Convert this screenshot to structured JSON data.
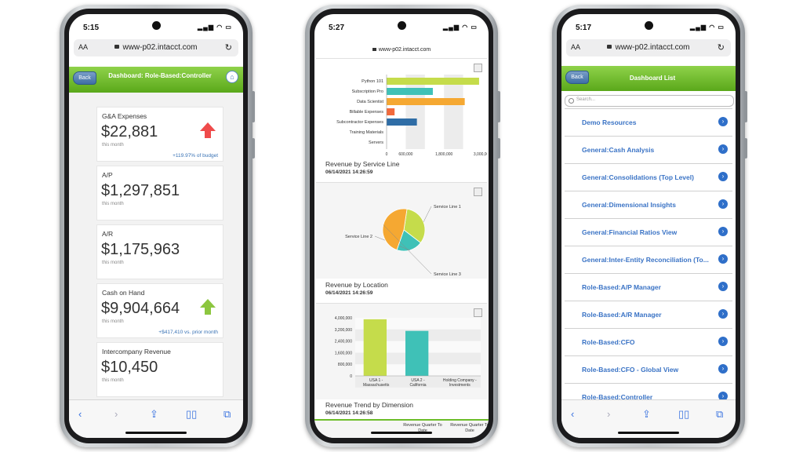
{
  "phone1": {
    "time": "5:15",
    "url": "www-p02.intacct.com",
    "aa": "AA",
    "back": "Back",
    "title": "Dashboard: Role-Based:Controller",
    "kpis": [
      {
        "label": "G&A Expenses",
        "value": "$22,881",
        "sub": "this month",
        "note": "+119.97% of budget",
        "trend": "up-red"
      },
      {
        "label": "A/P",
        "value": "$1,297,851",
        "sub": "this month",
        "note": "",
        "trend": ""
      },
      {
        "label": "A/R",
        "value": "$1,175,963",
        "sub": "this month",
        "note": "",
        "trend": ""
      },
      {
        "label": "Cash on Hand",
        "value": "$9,904,664",
        "sub": "this month",
        "note": "+$417,410 vs. prior month",
        "trend": "up-green"
      },
      {
        "label": "Intercompany Revenue",
        "value": "$10,450",
        "sub": "this month",
        "note": "",
        "trend": ""
      }
    ]
  },
  "phone2": {
    "time": "5:27",
    "url": "www-p02.intacct.com",
    "hbar": {
      "categories": [
        "Python 101",
        "Subscription Pro",
        "Data Scientist",
        "Billable Expenses",
        "Subcontractor Expenses",
        "Training Materials",
        "Servers"
      ],
      "values": [
        2900000,
        1450000,
        2450000,
        250000,
        950000,
        0,
        0
      ],
      "colors": [
        "#c5dc4b",
        "#3fc1b7",
        "#f5a832",
        "#f26a3b",
        "#2f6da6",
        "#888888",
        "#888888"
      ],
      "ticks": [
        "0",
        "600,000",
        "1,800,000",
        "3,000,000"
      ],
      "title": "Revenue by Service Line",
      "date": "06/14/2021 14:26:59"
    },
    "pie": {
      "labels": [
        "Service Line 1",
        "Service Line 2",
        "Service Line 3"
      ],
      "values": [
        33,
        20,
        47
      ],
      "colors": [
        "#c5dc4b",
        "#3fc1b7",
        "#f5a832"
      ],
      "title": "Revenue by Location",
      "date": "06/14/2021 14:26:59"
    },
    "vbar": {
      "categories": [
        "USA 1 - Massachusetts",
        "USA 2 - California",
        "Holding Company - Investments"
      ],
      "values": [
        3900000,
        3100000,
        0
      ],
      "colors": [
        "#c5dc4b",
        "#3fc1b7",
        "#888888"
      ],
      "yticks": [
        "4,000,000",
        "3,200,000",
        "2,400,000",
        "1,600,000",
        "800,000",
        "0"
      ],
      "title": "Revenue Trend by Dimension",
      "date": "06/14/2021 14:26:58"
    },
    "table_headers": [
      "Revenue Quarter To Date",
      "Revenue Quarter To Date"
    ]
  },
  "phone3": {
    "time": "5:17",
    "url": "www-p02.intacct.com",
    "aa": "AA",
    "back": "Back",
    "title": "Dashboard List",
    "search_placeholder": "Search...",
    "items": [
      "Demo Resources",
      "General:Cash Analysis",
      "General:Consolidations (Top Level)",
      "General:Dimensional Insights",
      "General:Financial Ratios View",
      "General:Inter-Entity Reconciliation (To...",
      "Role-Based:A/P Manager",
      "Role-Based:A/R Manager",
      "Role-Based:CFO",
      "Role-Based:CFO - Global View",
      "Role-Based:Controller"
    ]
  },
  "toolbar_icons": [
    "back-icon",
    "forward-icon",
    "share-icon",
    "bookmarks-icon",
    "tabs-icon"
  ],
  "chart_data": [
    {
      "type": "bar",
      "title": "Revenue by Service Line",
      "categories": [
        "Python 101",
        "Subscription Pro",
        "Data Scientist",
        "Billable Expenses",
        "Subcontractor Expenses",
        "Training Materials",
        "Servers"
      ],
      "values": [
        2900000,
        1450000,
        2450000,
        250000,
        950000,
        0,
        0
      ],
      "xlim": [
        0,
        3000000
      ]
    },
    {
      "type": "pie",
      "title": "Revenue by Location",
      "categories": [
        "Service Line 1",
        "Service Line 2",
        "Service Line 3"
      ],
      "values": [
        33,
        20,
        47
      ]
    },
    {
      "type": "bar",
      "title": "Revenue Trend by Dimension",
      "categories": [
        "USA 1 - Massachusetts",
        "USA 2 - California",
        "Holding Company - Investments"
      ],
      "values": [
        3900000,
        3100000,
        0
      ],
      "ylim": [
        0,
        4000000
      ]
    }
  ]
}
